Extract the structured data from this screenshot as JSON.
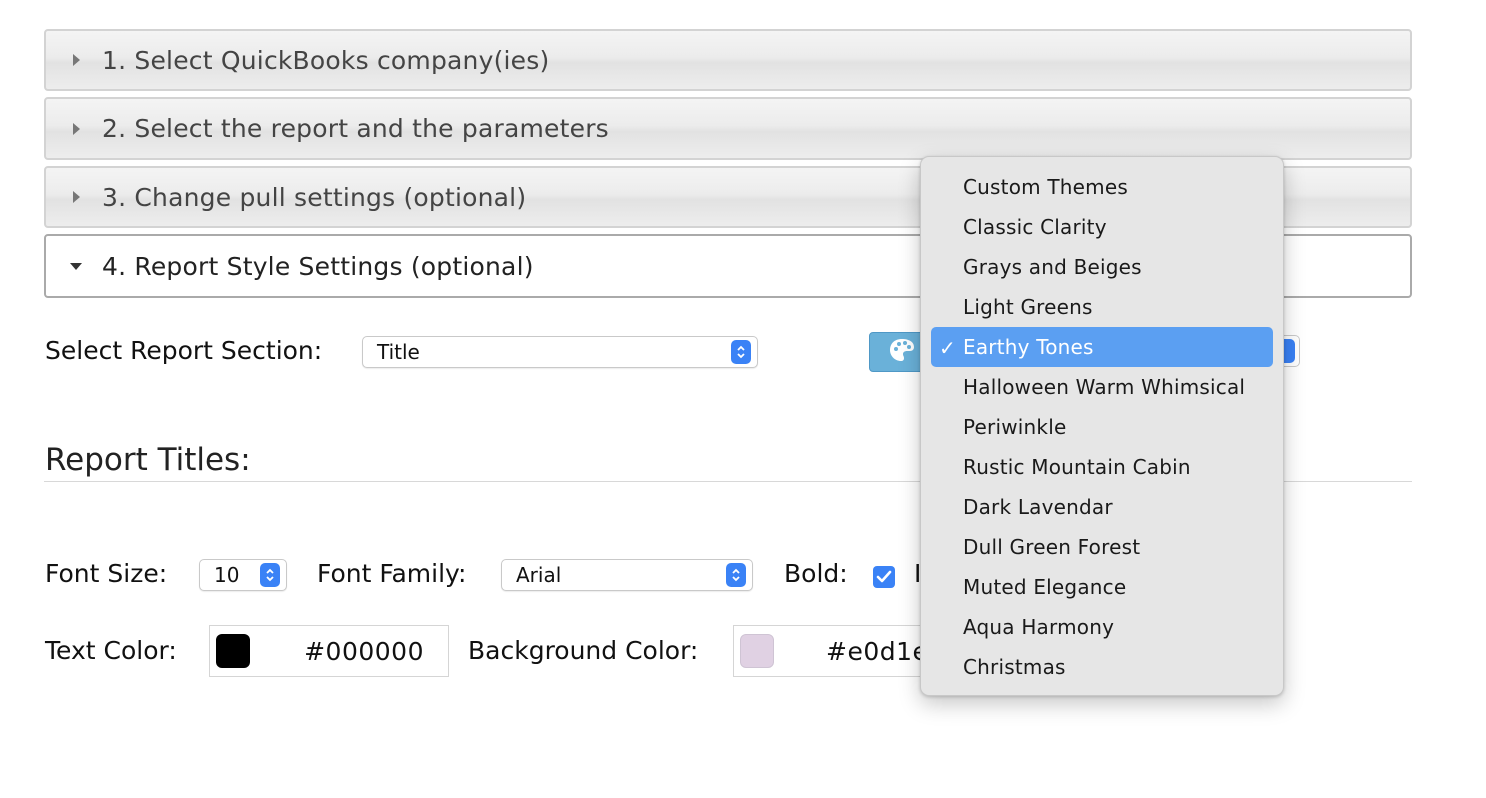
{
  "accordion": [
    {
      "label": "1. Select QuickBooks company(ies)",
      "open": false
    },
    {
      "label": "2. Select the report and the parameters",
      "open": false
    },
    {
      "label": "3. Change pull settings (optional)",
      "open": false
    },
    {
      "label": "4. Report Style Settings (optional)",
      "open": true
    }
  ],
  "section_select": {
    "label": "Select Report Section:",
    "value": "Title"
  },
  "report_titles": {
    "heading": "Report Titles:",
    "font_size": {
      "label": "Font Size:",
      "value": "10"
    },
    "font_family": {
      "label": "Font Family:",
      "value": "Arial"
    },
    "bold": {
      "label": "Bold:",
      "checked": true
    },
    "text_color": {
      "label": "Text Color:",
      "hex": "#000000",
      "swatch": "#000000"
    },
    "background_color": {
      "label": "Background Color:",
      "hex": "#e0d1e",
      "swatch": "#e0d1e3"
    }
  },
  "theme_dropdown": {
    "selected": "Earthy Tones",
    "options": [
      "Custom Themes",
      "Classic Clarity",
      "Grays and Beiges",
      "Light Greens",
      "Earthy Tones",
      "Halloween Warm Whimsical",
      "Periwinkle",
      "Rustic Mountain Cabin",
      "Dark Lavendar",
      "Dull Green Forest",
      "Muted Elegance",
      "Aqua Harmony",
      "Christmas"
    ]
  },
  "colors": {
    "accent": "#3a82f6",
    "selection": "#5b9ff2",
    "theme_button": "#6ab1d9"
  }
}
